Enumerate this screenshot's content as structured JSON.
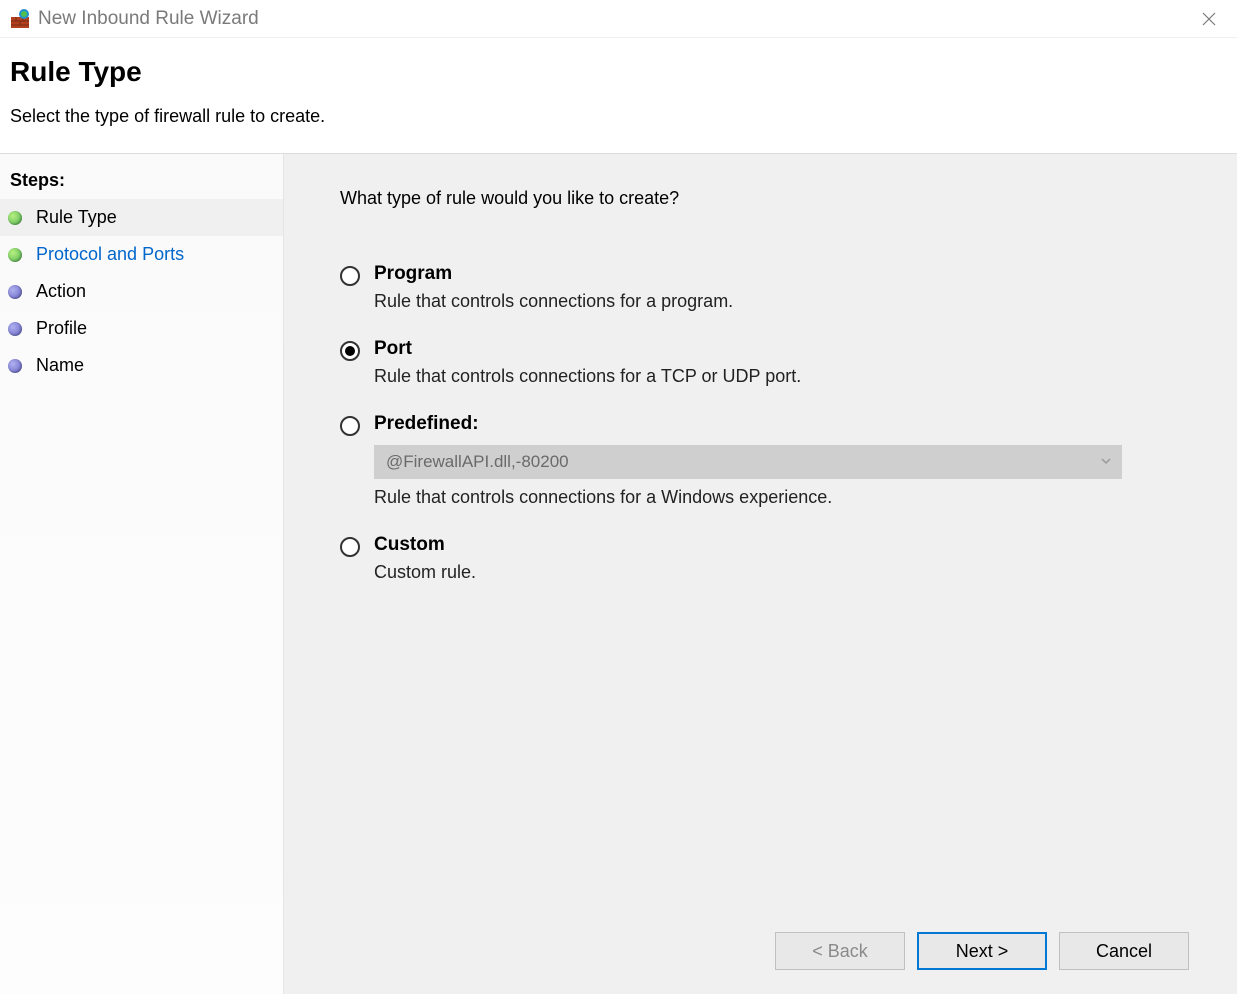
{
  "titlebar": {
    "title": "New Inbound Rule Wizard"
  },
  "header": {
    "title": "Rule Type",
    "subtitle": "Select the type of firewall rule to create."
  },
  "sidebar": {
    "heading": "Steps:",
    "items": [
      {
        "label": "Rule Type",
        "color": "green",
        "active": true,
        "link": false
      },
      {
        "label": "Protocol and Ports",
        "color": "green",
        "active": false,
        "link": true
      },
      {
        "label": "Action",
        "color": "blue",
        "active": false,
        "link": false
      },
      {
        "label": "Profile",
        "color": "blue",
        "active": false,
        "link": false
      },
      {
        "label": "Name",
        "color": "blue",
        "active": false,
        "link": false
      }
    ]
  },
  "main": {
    "question": "What type of rule would you like to create?",
    "options": {
      "program": {
        "title": "Program",
        "desc": "Rule that controls connections for a program."
      },
      "port": {
        "title": "Port",
        "desc": "Rule that controls connections for a TCP or UDP port."
      },
      "predefined": {
        "title": "Predefined:",
        "selected_value": "@FirewallAPI.dll,-80200",
        "desc": "Rule that controls connections for a Windows experience."
      },
      "custom": {
        "title": "Custom",
        "desc": "Custom rule."
      }
    },
    "selected": "port"
  },
  "footer": {
    "back": "< Back",
    "next": "Next >",
    "cancel": "Cancel"
  }
}
